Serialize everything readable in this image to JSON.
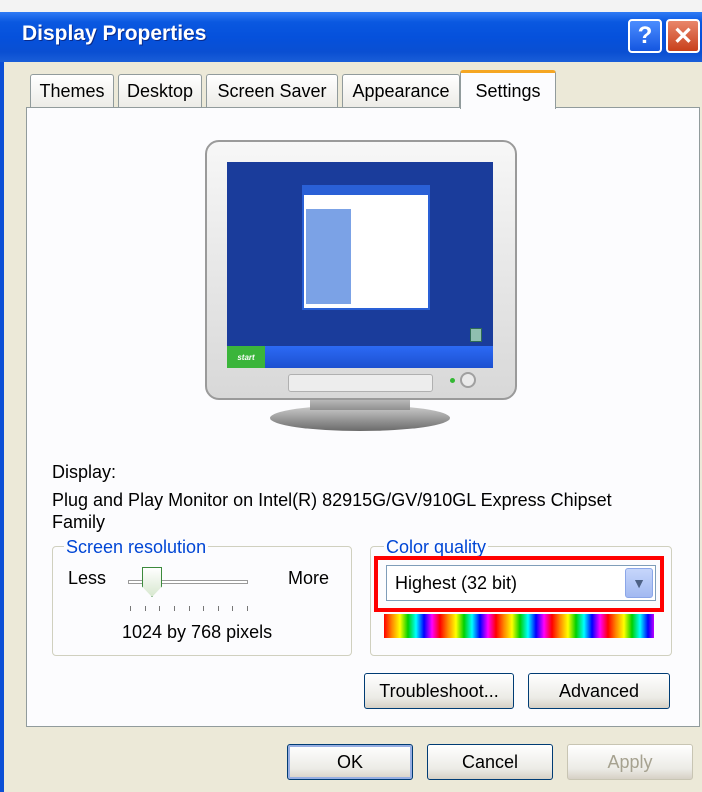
{
  "window": {
    "title": "Display Properties",
    "help_glyph": "?",
    "close_glyph": "✕"
  },
  "tabs": [
    {
      "label": "Themes",
      "active": false
    },
    {
      "label": "Desktop",
      "active": false
    },
    {
      "label": "Screen Saver",
      "active": false
    },
    {
      "label": "Appearance",
      "active": false
    },
    {
      "label": "Settings",
      "active": true
    }
  ],
  "preview": {
    "start_label": "start"
  },
  "display": {
    "label": "Display:",
    "monitor_line1": "Plug and Play Monitor on Intel(R) 82915G/GV/910GL Express Chipset",
    "monitor_line2": "Family"
  },
  "resolution": {
    "group_label": "Screen resolution",
    "less_label": "Less",
    "more_label": "More",
    "value_label": "1024 by 768 pixels",
    "slider_level": 0.2
  },
  "color_quality": {
    "group_label": "Color quality",
    "selected": "Highest (32 bit)",
    "highlight_color": "#ff0000"
  },
  "buttons": {
    "troubleshoot": "Troubleshoot...",
    "advanced": "Advanced",
    "ok": "OK",
    "cancel": "Cancel",
    "apply": "Apply"
  },
  "colors": {
    "titlebar": "#0551dc",
    "accent_tab": "#f5a623",
    "group_legend": "#0046d5"
  }
}
